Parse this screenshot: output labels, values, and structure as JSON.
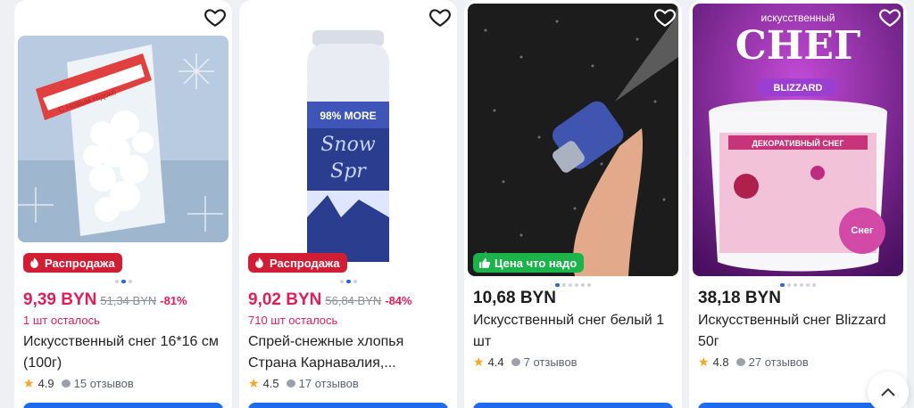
{
  "products": [
    {
      "badge": "Распродажа",
      "badge_type": "sale",
      "price": "9,39 BYN",
      "old_price": "51,34 BYN",
      "discount": "-81%",
      "stock": "1 шт осталось",
      "title": "Искусственный снег 16*16 см (100г)",
      "rating": "4.9",
      "reviews": "15 отзывов"
    },
    {
      "badge": "Распродажа",
      "badge_type": "sale",
      "price": "9,02 BYN",
      "old_price": "56,84 BYN",
      "discount": "-84%",
      "stock": "710 шт осталось",
      "title": "Спрей-снежные хлопья Страна Карнавалия,...",
      "rating": "4.5",
      "reviews": "17 отзывов"
    },
    {
      "badge": "Цена что надо",
      "badge_type": "good",
      "price": "10,68 BYN",
      "title": "Искусственный снег белый 1 шт",
      "rating": "4.4",
      "reviews": "7 отзывов"
    },
    {
      "price": "38,18 BYN",
      "title": "Искусственный снег Blizzard 50г",
      "rating": "4.8",
      "reviews": "27 отзывов",
      "image_text": {
        "top": "искусственный",
        "big": "СНЕГ",
        "brand": "BLIZZARD",
        "label": "ДЕКОРАТИВНЫЙ СНЕГ",
        "jar_word": "Снег"
      }
    }
  ],
  "image_text_card2": "98% MORE",
  "image_text_card1": "С Новым годом!",
  "colors": {
    "sale": "#e01e5a",
    "sale_badge": "#d21e34",
    "good_badge": "#1bb34a",
    "button": "#1f6bf0"
  },
  "icons": [
    "heart-icon",
    "fire-icon",
    "thumbs-up-icon",
    "star-icon",
    "comment-icon",
    "chevron-up-icon"
  ]
}
